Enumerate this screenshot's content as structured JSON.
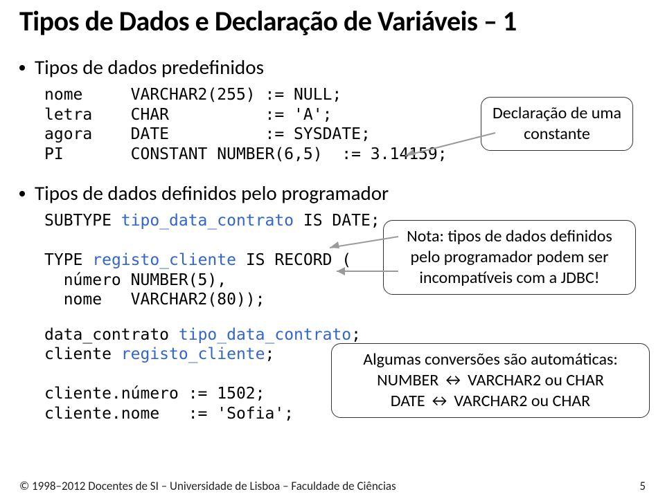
{
  "title": "Tipos de Dados e Declaração de Variáveis – 1",
  "bullets": {
    "b1": "Tipos de dados predefinidos",
    "b2": "Tipos de dados definidos pelo programador"
  },
  "code1": {
    "l1a": "nome     VARCHAR2(255) := NULL;",
    "l2a": "letra    CHAR          := 'A';",
    "l3a": "agora    DATE          := SYSDATE;",
    "l4a": "PI       CONSTANT NUMBER(6,5)  := 3.14159;"
  },
  "code2": {
    "l1a": "SUBTYPE ",
    "l1b": "tipo_data_contrato",
    "l1c": " IS DATE;",
    "l2a": "TYPE ",
    "l2b": "registo_cliente",
    "l2c": " IS RECORD (",
    "l3": "  número NUMBER(5),",
    "l4": "  nome   VARCHAR2(80));"
  },
  "code3": {
    "l1a": "data_contrato ",
    "l1b": "tipo_data_contrato",
    "l1c": ";",
    "l2a": "cliente ",
    "l2b": "registo_cliente",
    "l2c": ";",
    "l3": "cliente.número := 1502;",
    "l4": "cliente.nome   := 'Sofia';"
  },
  "callouts": {
    "c1": "Declaração de uma constante",
    "c2": "Nota: tipos de dados definidos pelo programador podem ser incompatíveis com a JDBC!",
    "c3_line1": "Algumas conversões são automáticas:",
    "c3_line2a": "NUMBER ",
    "c3_line2b": " VARCHAR2 ou CHAR",
    "c3_line3a": "DATE ",
    "c3_line3b": " VARCHAR2 ou CHAR",
    "swap": "↔"
  },
  "footer": "© 1998–2012  Docentes de SI – Universidade de Lisboa – Faculdade de Ciências",
  "page": "5"
}
